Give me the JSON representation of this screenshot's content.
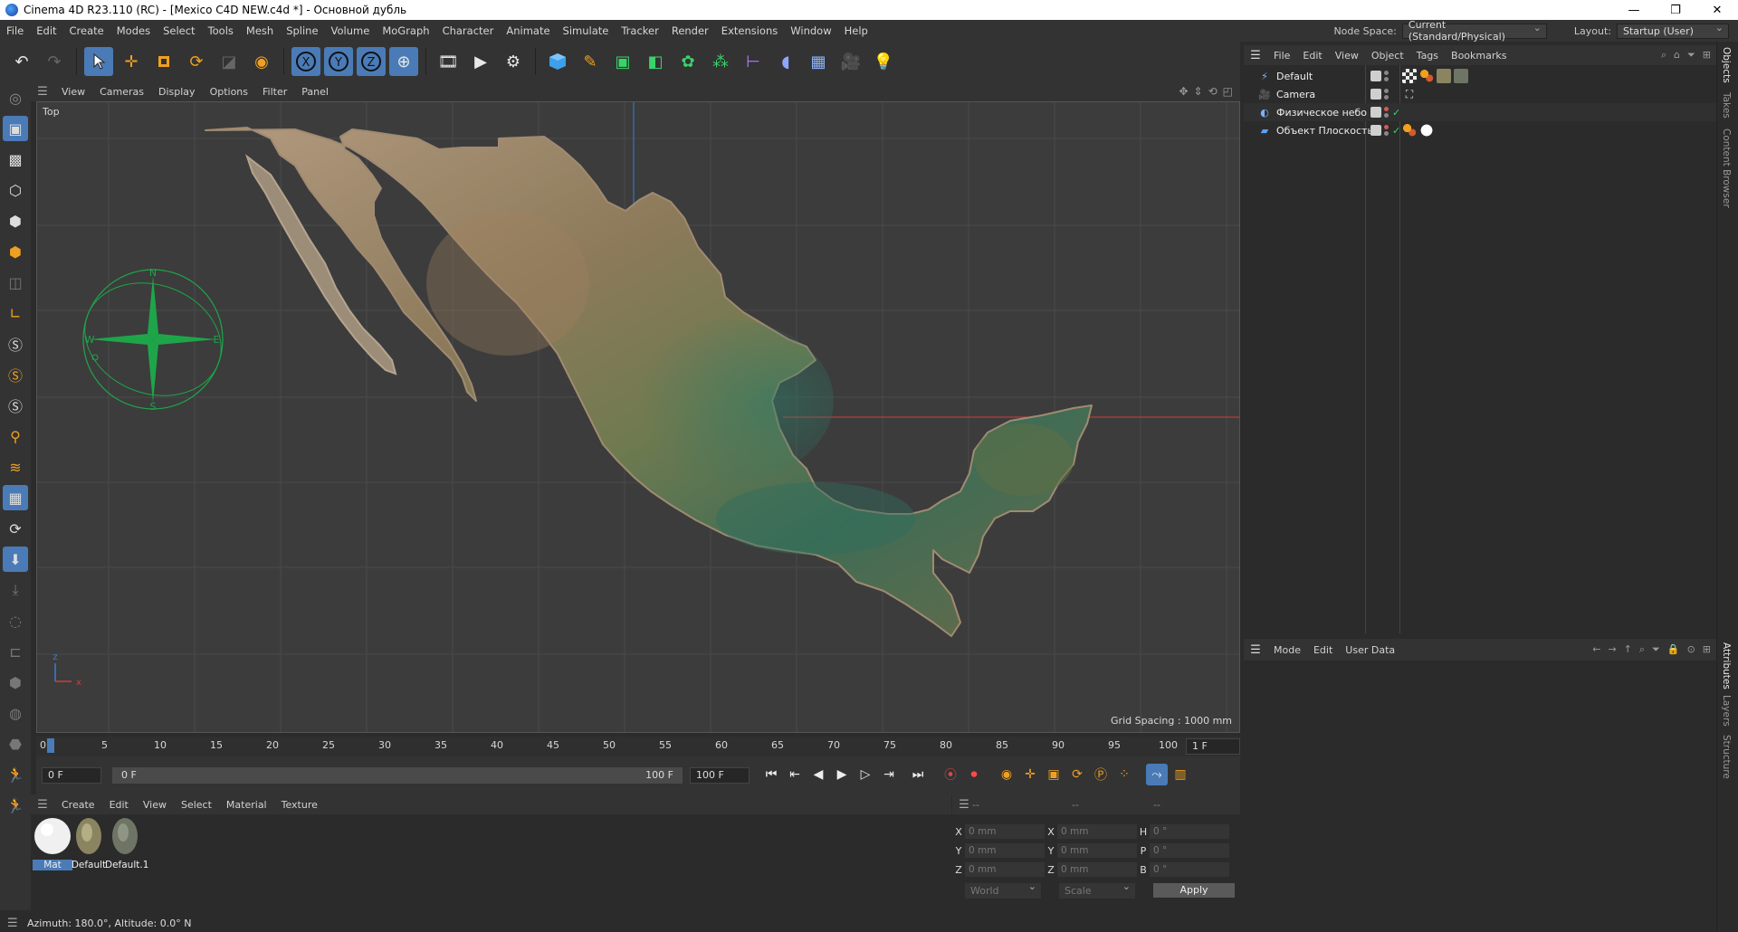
{
  "window": {
    "title": "Cinema 4D R23.110 (RC) - [Mexico C4D NEW.c4d *] - Основной дубль",
    "controls": [
      "—",
      "❐",
      "✕"
    ]
  },
  "menubar": {
    "items": [
      "File",
      "Edit",
      "Create",
      "Modes",
      "Select",
      "Tools",
      "Mesh",
      "Spline",
      "Volume",
      "MoGraph",
      "Character",
      "Animate",
      "Simulate",
      "Tracker",
      "Render",
      "Extensions",
      "Window",
      "Help"
    ],
    "node_space_label": "Node Space:",
    "node_space_value": "Current (Standard/Physical)",
    "layout_label": "Layout:",
    "layout_value": "Startup (User)"
  },
  "toolbar": {
    "buttons": [
      "undo-icon",
      "redo-icon",
      "select-tool-icon",
      "move-icon",
      "scale-icon",
      "rotate-icon",
      "recent-tool-icon",
      "live-select-icon",
      "x-axis-icon",
      "y-axis-icon",
      "z-axis-icon",
      "world-coords-icon",
      "render-region-icon",
      "render-view-icon",
      "render-settings-icon",
      "cube-icon",
      "pen-icon",
      "subdivision-icon",
      "extrude-icon",
      "cloner-icon",
      "field-icon",
      "bend-icon",
      "scene-icon",
      "floor-icon",
      "camera-icon",
      "light-icon"
    ],
    "axis_labels": [
      "X",
      "Y",
      "Z"
    ]
  },
  "viewport": {
    "menu": [
      "View",
      "Cameras",
      "Display",
      "Options",
      "Filter",
      "Panel"
    ],
    "view_name": "Top",
    "grid_spacing": "Grid Spacing : 1000 mm",
    "compass_letters": [
      "N",
      "E",
      "S",
      "W"
    ],
    "axis_x": "x",
    "axis_z": "z"
  },
  "timeline": {
    "ticks": [
      "0",
      "5",
      "10",
      "15",
      "20",
      "25",
      "30",
      "35",
      "40",
      "45",
      "50",
      "55",
      "60",
      "65",
      "70",
      "75",
      "80",
      "85",
      "90",
      "95",
      "100"
    ],
    "current_frame": "1 F",
    "start_field": "0 F",
    "range_start": "0 F",
    "range_end": "100 F",
    "end_field": "100 F"
  },
  "material_manager": {
    "menu": [
      "Create",
      "Edit",
      "View",
      "Select",
      "Material",
      "Texture"
    ],
    "materials": [
      {
        "name": "Mat",
        "selected": true
      },
      {
        "name": "Default",
        "selected": false
      },
      {
        "name": "Default.1",
        "selected": false
      }
    ]
  },
  "coordinates": {
    "headers": [
      "--",
      "--",
      "--"
    ],
    "rows": [
      {
        "a": "X",
        "a_val": "0 mm",
        "b": "X",
        "b_val": "0 mm",
        "c": "H",
        "c_val": "0 °"
      },
      {
        "a": "Y",
        "a_val": "0 mm",
        "b": "Y",
        "b_val": "0 mm",
        "c": "P",
        "c_val": "0 °"
      },
      {
        "a": "Z",
        "a_val": "0 mm",
        "b": "Z",
        "b_val": "0 mm",
        "c": "B",
        "c_val": "0 °"
      }
    ],
    "mode_world": "World",
    "mode_scale": "Scale",
    "apply": "Apply"
  },
  "status": {
    "text": "Azimuth: 180.0°, Altitude: 0.0°  N"
  },
  "object_manager": {
    "menu": [
      "File",
      "Edit",
      "View",
      "Object",
      "Tags",
      "Bookmarks"
    ],
    "objects": [
      {
        "name": "Default",
        "icon": "⚡",
        "color": "#8fb4ff"
      },
      {
        "name": "Camera",
        "icon": "🎥",
        "color": "#cccccc"
      },
      {
        "name": "Физическое небо",
        "icon": "◐",
        "color": "#7fb0ff"
      },
      {
        "name": "Объект Плоскость",
        "icon": "▰",
        "color": "#5aa0ff"
      }
    ]
  },
  "attributes_manager": {
    "menu": [
      "Mode",
      "Edit",
      "User Data"
    ]
  },
  "side_tabs": {
    "top": [
      "Objects",
      "Takes",
      "Content Browser"
    ],
    "bottom": [
      "Attributes",
      "Layers",
      "Structure"
    ]
  }
}
